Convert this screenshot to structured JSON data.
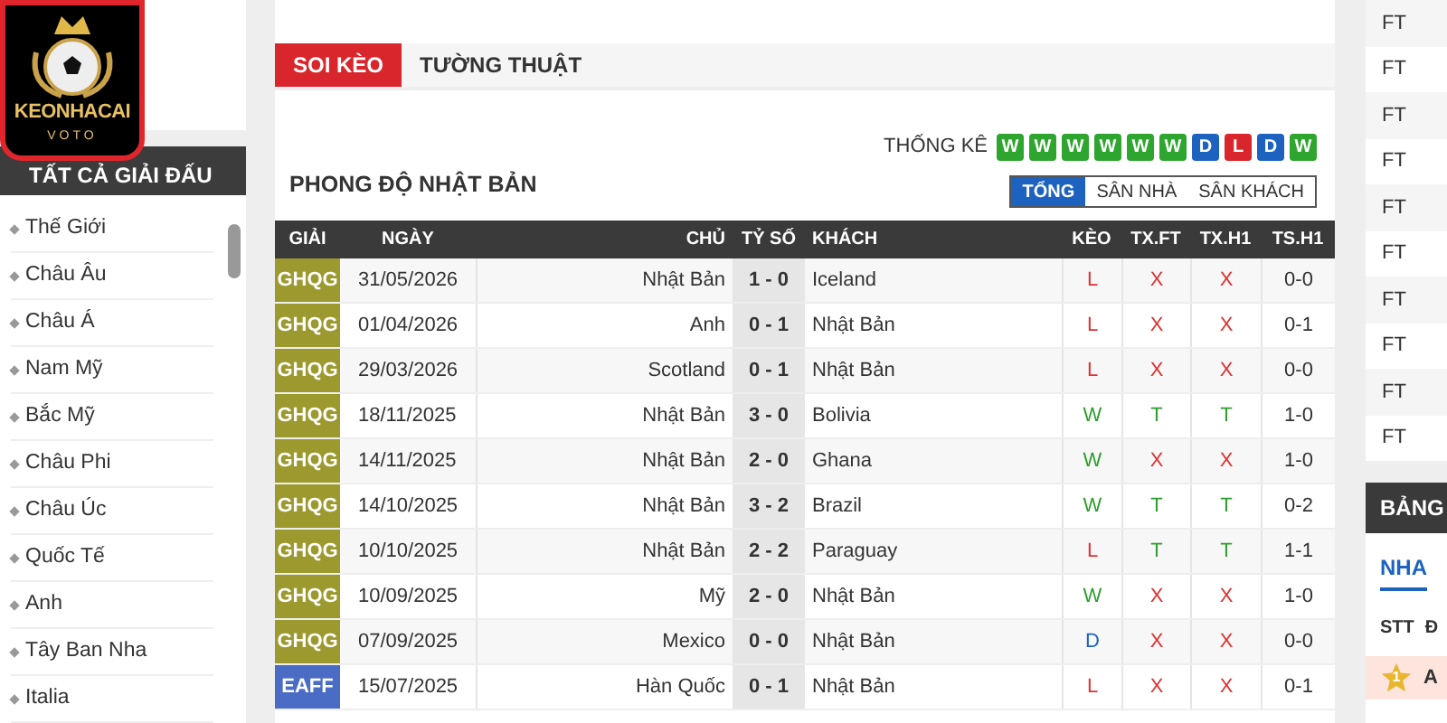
{
  "logo": {
    "name": "KEONHACAI",
    "sub": "VOTO"
  },
  "sidebar": {
    "title": "TẤT CẢ GIẢI ĐẤU",
    "items": [
      "Thế Giới",
      "Châu Âu",
      "Châu Á",
      "Nam Mỹ",
      "Bắc Mỹ",
      "Châu Phi",
      "Châu Úc",
      "Quốc Tế",
      "Anh",
      "Tây Ban Nha",
      "Italia"
    ]
  },
  "tabs": [
    {
      "label": "SOI KÈO",
      "selected": true
    },
    {
      "label": "TƯỜNG THUẬT",
      "selected": false
    }
  ],
  "stats": {
    "label": "THỐNG KÊ",
    "badges": [
      {
        "text": "W",
        "kind": "win"
      },
      {
        "text": "W",
        "kind": "win"
      },
      {
        "text": "W",
        "kind": "win"
      },
      {
        "text": "W",
        "kind": "win"
      },
      {
        "text": "W",
        "kind": "win"
      },
      {
        "text": "W",
        "kind": "win"
      },
      {
        "text": "D",
        "kind": "draw"
      },
      {
        "text": "L",
        "kind": "loss"
      },
      {
        "text": "D",
        "kind": "draw"
      },
      {
        "text": "W",
        "kind": "win"
      }
    ]
  },
  "filters": [
    {
      "label": "TỔNG",
      "selected": true
    },
    {
      "label": "SÂN NHÀ",
      "selected": false
    },
    {
      "label": "SÂN KHÁCH",
      "selected": false
    }
  ],
  "title": "PHONG ĐỘ NHẬT BẢN",
  "table": {
    "columns": [
      "GIẢI",
      "NGÀY",
      "CHỦ",
      "TỶ SỐ",
      "KHÁCH",
      "KÈO",
      "TX.FT",
      "TX.H1",
      "TS.H1"
    ],
    "rows": [
      {
        "league": "GHQG",
        "color": "#9c9a2e",
        "date": "31/05/2026",
        "home": "Nhật Bản",
        "score": "1 - 0",
        "away": "Iceland",
        "keo": {
          "text": "L",
          "kind": "loss"
        },
        "txft": {
          "text": "X",
          "kind": "under"
        },
        "txh1": {
          "text": "X",
          "kind": "under"
        },
        "tsh1": "0-0"
      },
      {
        "league": "GHQG",
        "color": "#9c9a2e",
        "date": "01/04/2026",
        "home": "Anh",
        "score": "0 - 1",
        "away": "Nhật Bản",
        "keo": {
          "text": "L",
          "kind": "loss"
        },
        "txft": {
          "text": "X",
          "kind": "under"
        },
        "txh1": {
          "text": "X",
          "kind": "under"
        },
        "tsh1": "0-1"
      },
      {
        "league": "GHQG",
        "color": "#9c9a2e",
        "date": "29/03/2026",
        "home": "Scotland",
        "score": "0 - 1",
        "away": "Nhật Bản",
        "keo": {
          "text": "L",
          "kind": "loss"
        },
        "txft": {
          "text": "X",
          "kind": "under"
        },
        "txh1": {
          "text": "X",
          "kind": "under"
        },
        "tsh1": "0-0"
      },
      {
        "league": "GHQG",
        "color": "#9c9a2e",
        "date": "18/11/2025",
        "home": "Nhật Bản",
        "score": "3 - 0",
        "away": "Bolivia",
        "keo": {
          "text": "W",
          "kind": "win"
        },
        "txft": {
          "text": "T",
          "kind": "over"
        },
        "txh1": {
          "text": "T",
          "kind": "over"
        },
        "tsh1": "1-0"
      },
      {
        "league": "GHQG",
        "color": "#9c9a2e",
        "date": "14/11/2025",
        "home": "Nhật Bản",
        "score": "2 - 0",
        "away": "Ghana",
        "keo": {
          "text": "W",
          "kind": "win"
        },
        "txft": {
          "text": "X",
          "kind": "under"
        },
        "txh1": {
          "text": "X",
          "kind": "under"
        },
        "tsh1": "1-0"
      },
      {
        "league": "GHQG",
        "color": "#9c9a2e",
        "date": "14/10/2025",
        "home": "Nhật Bản",
        "score": "3 - 2",
        "away": "Brazil",
        "keo": {
          "text": "W",
          "kind": "win"
        },
        "txft": {
          "text": "T",
          "kind": "over"
        },
        "txh1": {
          "text": "T",
          "kind": "over"
        },
        "tsh1": "0-2"
      },
      {
        "league": "GHQG",
        "color": "#9c9a2e",
        "date": "10/10/2025",
        "home": "Nhật Bản",
        "score": "2 - 2",
        "away": "Paraguay",
        "keo": {
          "text": "L",
          "kind": "loss"
        },
        "txft": {
          "text": "T",
          "kind": "over"
        },
        "txh1": {
          "text": "T",
          "kind": "over"
        },
        "tsh1": "1-1"
      },
      {
        "league": "GHQG",
        "color": "#9c9a2e",
        "date": "10/09/2025",
        "home": "Mỹ",
        "score": "2 - 0",
        "away": "Nhật Bản",
        "keo": {
          "text": "W",
          "kind": "win"
        },
        "txft": {
          "text": "X",
          "kind": "under"
        },
        "txh1": {
          "text": "X",
          "kind": "under"
        },
        "tsh1": "1-0"
      },
      {
        "league": "GHQG",
        "color": "#9c9a2e",
        "date": "07/09/2025",
        "home": "Mexico",
        "score": "0 - 0",
        "away": "Nhật Bản",
        "keo": {
          "text": "D",
          "kind": "draw"
        },
        "txft": {
          "text": "X",
          "kind": "under"
        },
        "txh1": {
          "text": "X",
          "kind": "under"
        },
        "tsh1": "0-0"
      },
      {
        "league": "EAFF",
        "color": "#4a6cc4",
        "date": "15/07/2025",
        "home": "Hàn Quốc",
        "score": "0 - 1",
        "away": "Nhật Bản",
        "keo": {
          "text": "L",
          "kind": "loss"
        },
        "txft": {
          "text": "X",
          "kind": "under"
        },
        "txh1": {
          "text": "X",
          "kind": "under"
        },
        "tsh1": "0-1"
      }
    ]
  },
  "right": {
    "statuses": [
      "FT",
      "FT",
      "FT",
      "FT",
      "FT",
      "FT",
      "FT",
      "FT",
      "FT",
      "FT"
    ],
    "standings_title": "BẢNG",
    "tab": "NHA",
    "columns": [
      "STT",
      "Đ"
    ],
    "rows": [
      {
        "rank": "1",
        "team": "A"
      }
    ]
  }
}
